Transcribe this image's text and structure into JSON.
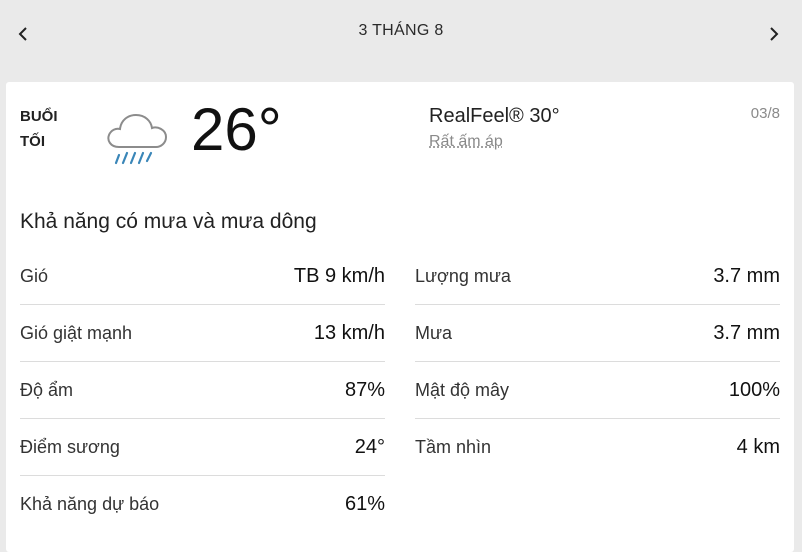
{
  "header": {
    "title": "3 THÁNG 8",
    "prev_icon": "chevron-left-icon",
    "next_icon": "chevron-right-icon"
  },
  "forecast": {
    "period_line1": "BUỔI",
    "period_line2": "TỐI",
    "icon": "cloud-rain-icon",
    "temperature": "26°",
    "realfeel": "RealFeel® 30°",
    "realfeel_phrase": "Rất ấm áp",
    "date": "03/8",
    "phrase": "Khả năng có mưa và mưa dông"
  },
  "details_left": [
    {
      "label": "Gió",
      "value": "TB 9 km/h"
    },
    {
      "label": "Gió giật mạnh",
      "value": "13 km/h"
    },
    {
      "label": "Độ ẩm",
      "value": "87%"
    },
    {
      "label": "Điểm sương",
      "value": "24°"
    },
    {
      "label": "Khả năng dự báo",
      "value": "61%"
    }
  ],
  "details_right": [
    {
      "label": "Lượng mưa",
      "value": "3.7 mm"
    },
    {
      "label": "Mưa",
      "value": "3.7 mm"
    },
    {
      "label": "Mật độ mây",
      "value": "100%"
    },
    {
      "label": "Tầm nhìn",
      "value": "4 km"
    }
  ],
  "colors": {
    "background": "#eaeaea",
    "card": "#ffffff",
    "rain": "#3a86b8",
    "cloud_stroke": "#8c8c8c"
  }
}
